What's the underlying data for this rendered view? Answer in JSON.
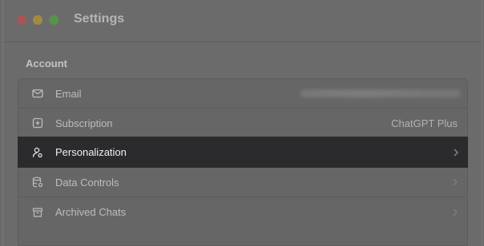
{
  "window": {
    "title": "Settings"
  },
  "account": {
    "section_label": "Account",
    "rows": [
      {
        "label": "Email",
        "value": "",
        "icon": "mail-icon"
      },
      {
        "label": "Subscription",
        "value": "ChatGPT Plus",
        "icon": "plus-square-icon"
      },
      {
        "label": "Personalization",
        "value": "",
        "icon": "person-settings-icon",
        "selected": true
      },
      {
        "label": "Data Controls",
        "value": "",
        "icon": "database-icon"
      },
      {
        "label": "Archived Chats",
        "value": "",
        "icon": "archive-box-icon"
      }
    ]
  },
  "colors": {
    "selected_row_bg": "#2b2b2d",
    "traffic_close": "#a85654",
    "traffic_minimize": "#a38a3f",
    "traffic_maximize": "#58934c"
  }
}
